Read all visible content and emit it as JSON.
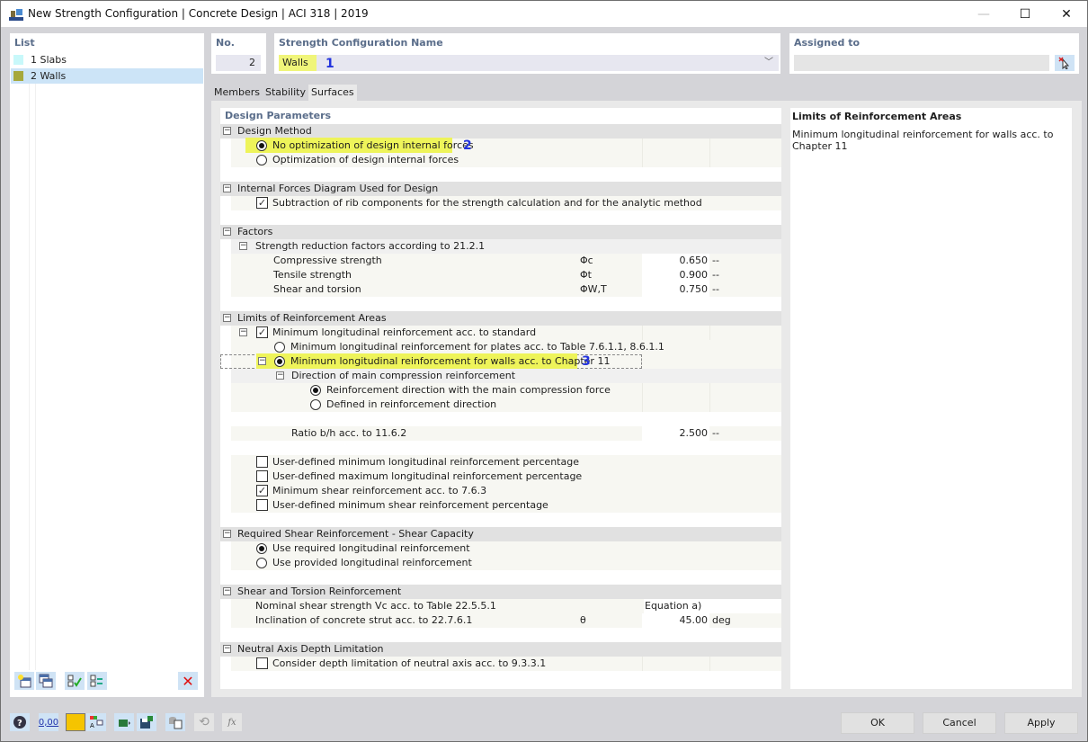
{
  "window": {
    "title": "New Strength Configuration | Concrete Design | ACI 318 | 2019",
    "minimize": "—",
    "maximize": "☐",
    "close": "✕"
  },
  "list": {
    "header": "List",
    "items": [
      {
        "label": "1 Slabs",
        "color": "#c8f8fa"
      },
      {
        "label": "2 Walls",
        "color": "#a6a83c",
        "selected": true
      }
    ],
    "toolbar": [
      "new-icon",
      "copy-icon",
      "check-all-icon",
      "toggle-check-icon",
      "delete-icon"
    ]
  },
  "header": {
    "no_label": "No.",
    "no_value": "2",
    "name_label": "Strength Configuration Name",
    "name_value": "Walls",
    "assigned_label": "Assigned to",
    "assigned_value": ""
  },
  "annotations": [
    "1",
    "2",
    "3"
  ],
  "tabs": [
    {
      "label": "Members"
    },
    {
      "label": "Stability"
    },
    {
      "label": "Surfaces",
      "active": true
    }
  ],
  "params": {
    "title": "Design Parameters",
    "design_method": {
      "label": "Design Method",
      "opt1": "No optimization of design internal forces",
      "opt2": "Optimization of design internal forces"
    },
    "internal_forces": {
      "label": "Internal Forces Diagram Used for Design",
      "opt1": "Subtraction of rib components for the strength calculation and for the analytic method"
    },
    "factors": {
      "label": "Factors",
      "sub": "Strength reduction factors according to 21.2.1",
      "rows": [
        {
          "label": "Compressive strength",
          "sym": "Φc",
          "value": "0.650",
          "unit": "--"
        },
        {
          "label": "Tensile strength",
          "sym": "Φt",
          "value": "0.900",
          "unit": "--"
        },
        {
          "label": "Shear and torsion",
          "sym": "ΦW,T",
          "value": "0.750",
          "unit": "--"
        }
      ]
    },
    "limits": {
      "label": "Limits of Reinforcement Areas",
      "min_long": "Minimum longitudinal reinforcement acc. to standard",
      "plates": "Minimum longitudinal reinforcement for plates acc. to Table 7.6.1.1, 8.6.1.1",
      "walls": "Minimum longitudinal reinforcement for walls acc. to Chapter 11",
      "direction": "Direction of main compression reinforcement",
      "dir1": "Reinforcement direction with the main compression force",
      "dir2": "Defined in reinforcement direction",
      "ratio_label": "Ratio b/h acc. to 11.6.2",
      "ratio_value": "2.500",
      "ratio_unit": "--",
      "ud_min": "User-defined minimum longitudinal reinforcement percentage",
      "ud_max": "User-defined maximum longitudinal reinforcement percentage",
      "min_shear": "Minimum shear reinforcement acc. to 7.6.3",
      "ud_min_shear": "User-defined minimum shear reinforcement percentage"
    },
    "req_shear": {
      "label": "Required Shear Reinforcement - Shear Capacity",
      "opt1": "Use required longitudinal reinforcement",
      "opt2": "Use provided longitudinal reinforcement"
    },
    "shear_torsion": {
      "label": "Shear and Torsion Reinforcement",
      "nominal": "Nominal shear strength Vc acc. to Table 22.5.5.1",
      "nominal_value": "Equation a)",
      "incl": "Inclination of concrete strut acc. to 22.7.6.1",
      "incl_sym": "θ",
      "incl_value": "45.00",
      "incl_unit": "deg"
    },
    "neutral": {
      "label": "Neutral Axis Depth Limitation",
      "opt1": "Consider depth limitation of neutral axis acc. to 9.3.3.1"
    }
  },
  "info": {
    "title": "Limits of Reinforcement Areas",
    "text": "Minimum longitudinal reinforcement for walls acc. to Chapter 11"
  },
  "footer": {
    "ok": "OK",
    "cancel": "Cancel",
    "apply": "Apply",
    "number_format": "0,00"
  }
}
